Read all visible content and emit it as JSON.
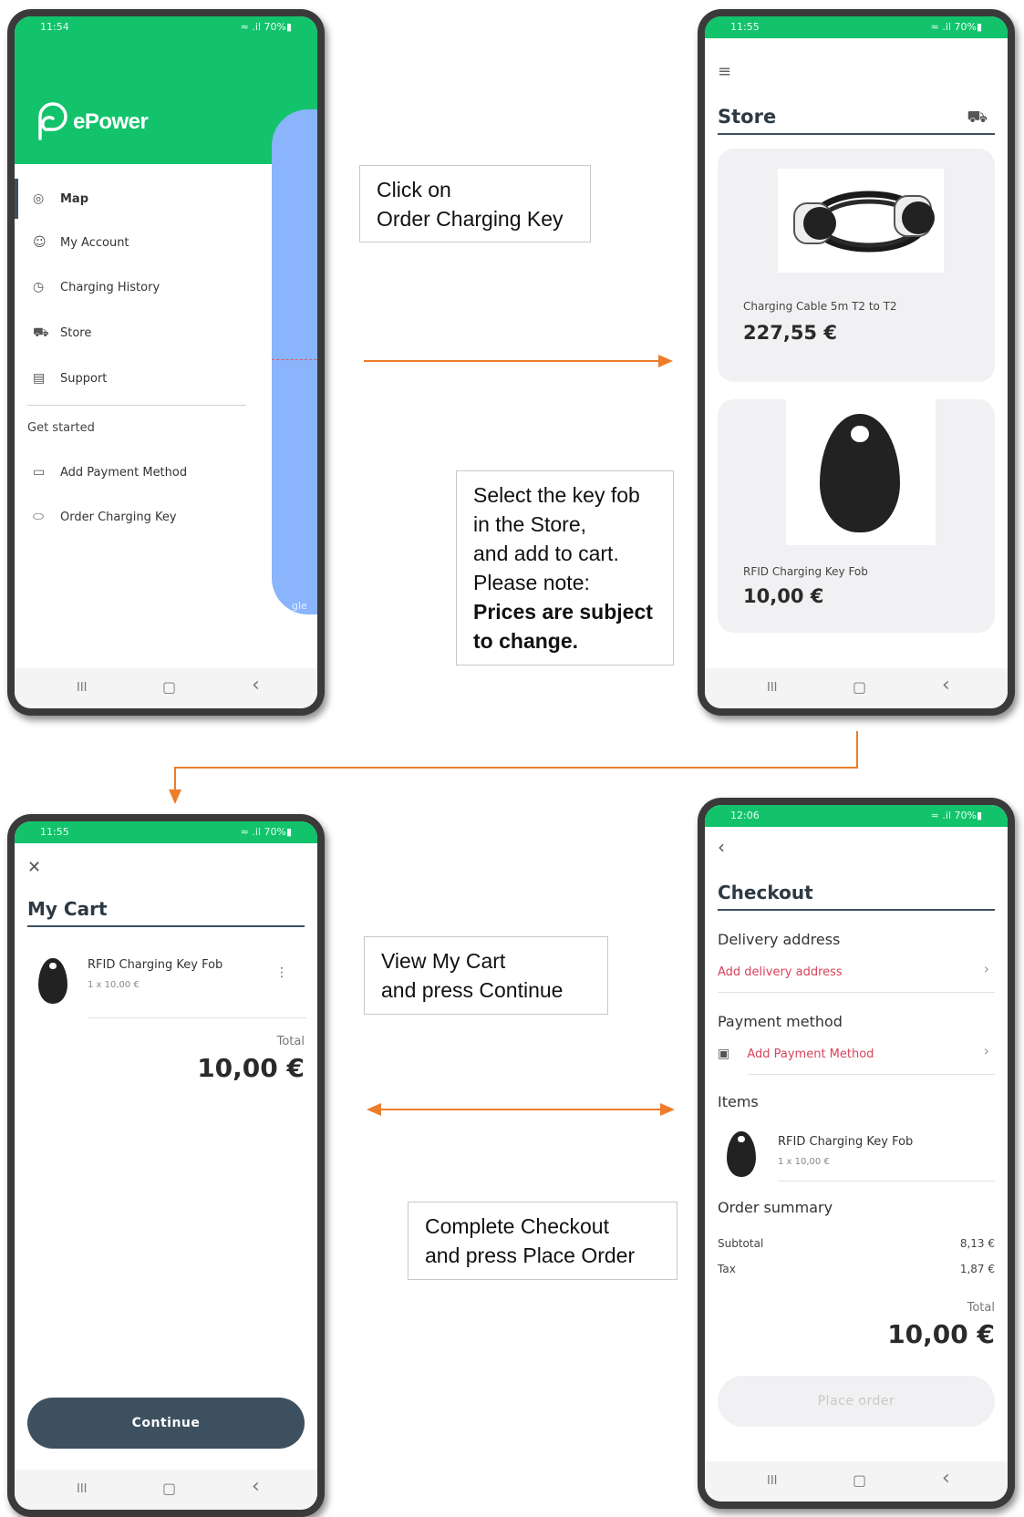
{
  "colors": {
    "brand_green": "#12c36b",
    "arrow": "#ee7c2a",
    "accent_dark": "#3d5060",
    "link_red": "#d8435a",
    "map_blue": "#8ab4fb"
  },
  "phone1": {
    "time": "11:54",
    "signal": "≈ .il 70%▮",
    "logo_text": "ePower",
    "menu": [
      {
        "icon": "map-pin-icon",
        "label": "Map"
      },
      {
        "icon": "account-icon",
        "label": "My Account"
      },
      {
        "icon": "history-icon",
        "label": "Charging History"
      },
      {
        "icon": "cart-icon",
        "label": "Store"
      },
      {
        "icon": "support-icon",
        "label": "Support"
      }
    ],
    "section_label": "Get started",
    "get_started": [
      {
        "icon": "card-icon",
        "label": "Add Payment Method"
      },
      {
        "icon": "key-tag-icon",
        "label": "Order Charging Key"
      }
    ],
    "map_watermark": "gle"
  },
  "phone2": {
    "time": "11:55",
    "signal": "≈ .il 70%▮",
    "title": "Store",
    "products": [
      {
        "name": "Charging Cable 5m T2 to T2",
        "price": "227,55 €"
      },
      {
        "name": "RFID Charging Key Fob",
        "price": "10,00 €"
      }
    ]
  },
  "phone3": {
    "time": "11:55",
    "signal": "≈ .il 70%▮",
    "title": "My Cart",
    "item_name": "RFID Charging Key Fob",
    "item_qty": "1 x 10,00 €",
    "total_label": "Total",
    "total": "10,00 €",
    "continue": "Continue"
  },
  "phone4": {
    "time": "12:06",
    "signal": "≈ .il 70%▮",
    "title": "Checkout",
    "delivery_heading": "Delivery address",
    "delivery_link": "Add delivery address",
    "payment_heading": "Payment method",
    "payment_link": "Add Payment Method",
    "items_heading": "Items",
    "item_name": "RFID Charging Key Fob",
    "item_qty": "1 x 10,00 €",
    "summary_heading": "Order summary",
    "subtotal_label": "Subtotal",
    "subtotal": "8,13 €",
    "tax_label": "Tax",
    "tax": "1,87 €",
    "total_label": "Total",
    "total": "10,00 €",
    "place_order": "Place order"
  },
  "nav": {
    "recent": "III",
    "home": "▢",
    "back": "‹"
  },
  "callouts": {
    "c1": [
      "Click on",
      "Order Charging Key"
    ],
    "c2": [
      "Select the key fob",
      "in the Store,",
      "and add to cart.",
      "Please note:"
    ],
    "c2_bold": [
      "Prices are subject",
      "to change."
    ],
    "c3": [
      "View My Cart",
      "and press Continue"
    ],
    "c4": [
      "Complete Checkout",
      "and press Place Order"
    ]
  }
}
